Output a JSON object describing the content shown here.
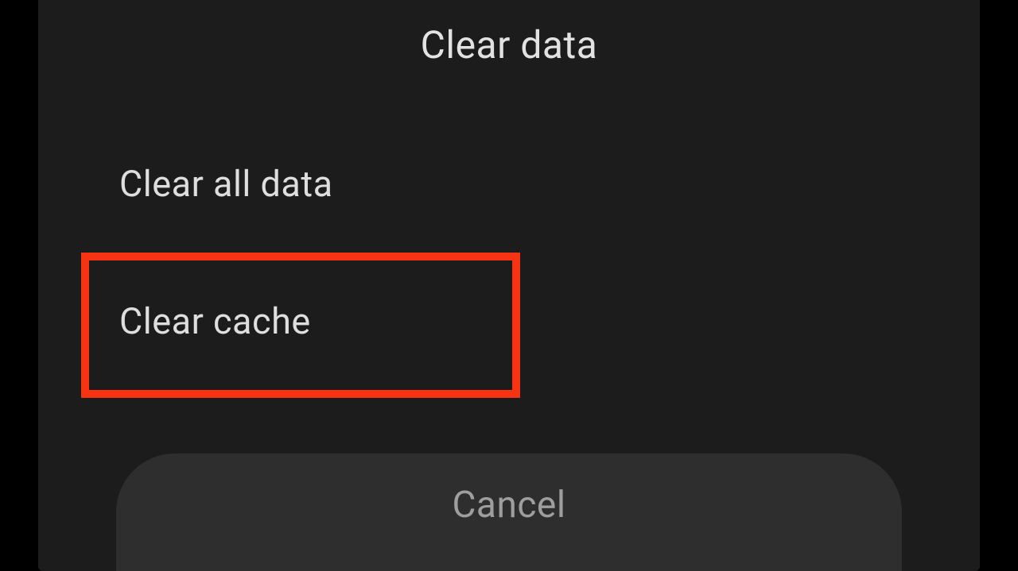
{
  "dialog": {
    "title": "Clear data",
    "options": {
      "clear_all_data": "Clear all data",
      "clear_cache": "Clear cache"
    },
    "cancel_label": "Cancel"
  },
  "highlight_color": "#f63313"
}
